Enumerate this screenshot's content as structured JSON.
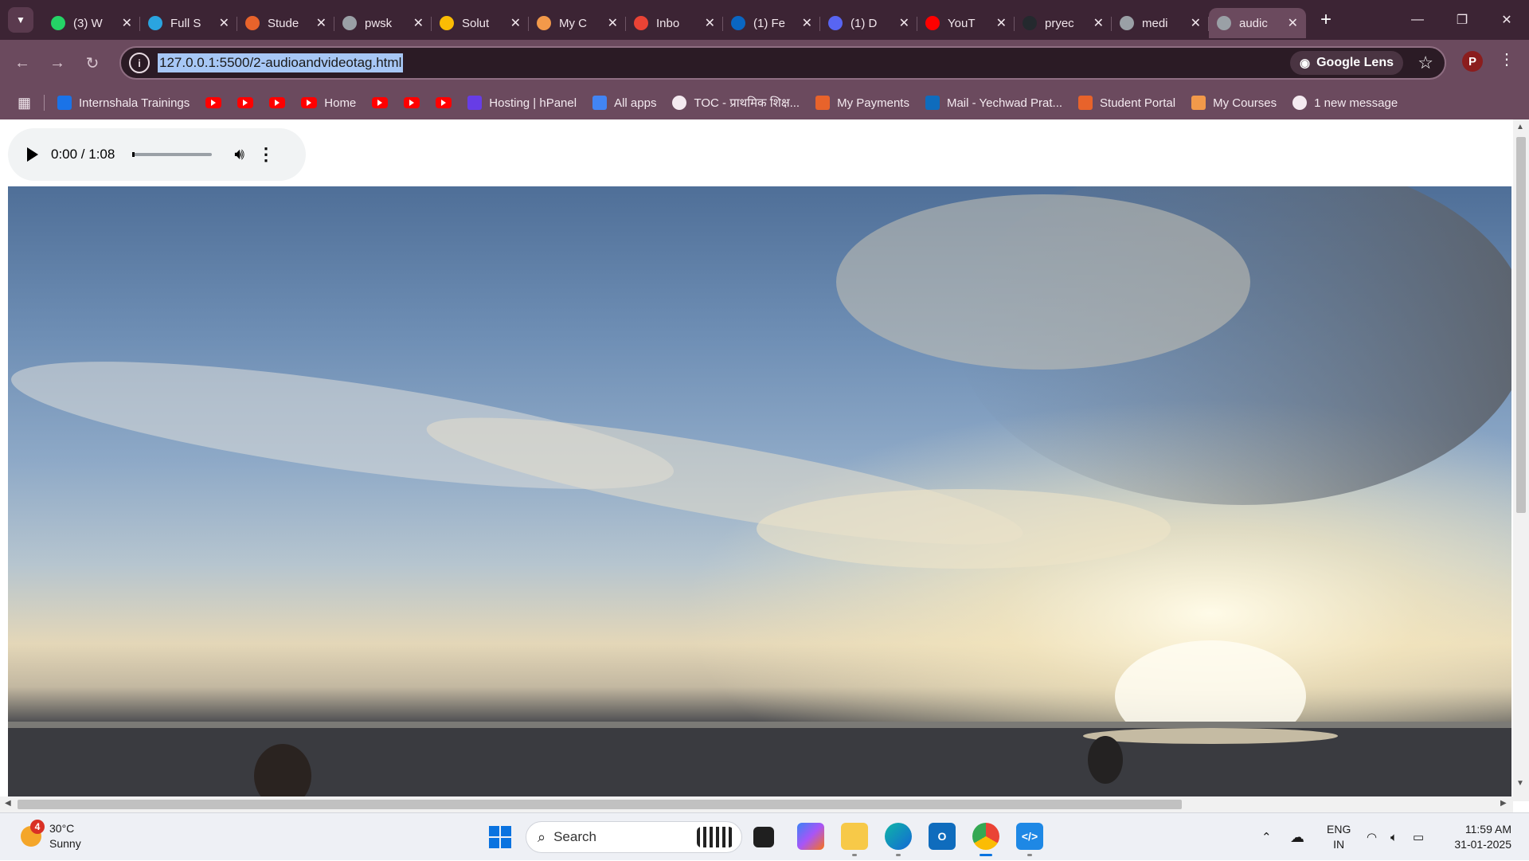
{
  "browser": {
    "tabs": [
      {
        "title": "(3) W",
        "icon": "whatsapp-icon",
        "color": "#25d366"
      },
      {
        "title": "Full S",
        "icon": "telegram-icon",
        "color": "#2aa4e0"
      },
      {
        "title": "Stude",
        "icon": "student-icon",
        "color": "#e8632b"
      },
      {
        "title": "pwsk",
        "icon": "globe-icon",
        "color": "#9aa0a6"
      },
      {
        "title": "Solut",
        "icon": "google-drive-icon",
        "color": "#fbbc04"
      },
      {
        "title": "My C",
        "icon": "courses-icon",
        "color": "#f2994a"
      },
      {
        "title": "Inbo",
        "icon": "gmail-icon",
        "color": "#ea4335"
      },
      {
        "title": "(1) Fe",
        "icon": "linkedin-icon",
        "color": "#0a66c2"
      },
      {
        "title": "(1) D",
        "icon": "discord-icon",
        "color": "#5865f2"
      },
      {
        "title": "YouT",
        "icon": "youtube-icon",
        "color": "#ff0000"
      },
      {
        "title": "pryec",
        "icon": "github-icon",
        "color": "#24292e"
      },
      {
        "title": "medi",
        "icon": "globe-icon",
        "color": "#9aa0a6"
      },
      {
        "title": "audic",
        "icon": "globe-icon",
        "color": "#9aa0a6",
        "active": true
      }
    ],
    "url": "127.0.0.1:5500/2-audioandvideotag.html",
    "lens_label": "Google Lens",
    "profile_initial": "P",
    "bookmarks": [
      {
        "label": "Internshala Trainings",
        "icon": "ist"
      },
      {
        "label": "",
        "icon": "yt"
      },
      {
        "label": "",
        "icon": "yt"
      },
      {
        "label": "",
        "icon": "yt"
      },
      {
        "label": "Home",
        "icon": "yt"
      },
      {
        "label": "",
        "icon": "yt"
      },
      {
        "label": "",
        "icon": "yt"
      },
      {
        "label": "",
        "icon": "yt"
      },
      {
        "label": "Hosting | hPanel",
        "icon": "hostinger"
      },
      {
        "label": "All apps",
        "icon": "apps"
      },
      {
        "label": "TOC - प्राथमिक शिक्ष...",
        "icon": "toc"
      },
      {
        "label": "My Payments",
        "icon": "payments"
      },
      {
        "label": "Mail - Yechwad Prat...",
        "icon": "outlook"
      },
      {
        "label": "Student Portal",
        "icon": "portal"
      },
      {
        "label": "My Courses",
        "icon": "courses"
      },
      {
        "label": "1 new message",
        "icon": "globe"
      }
    ]
  },
  "audio_player": {
    "time": "0:00 / 1:08",
    "progress": 0.0
  },
  "taskbar": {
    "weather_temp": "30°C",
    "weather_desc": "Sunny",
    "weather_badge": "4",
    "search_placeholder": "Search",
    "lang_top": "ENG",
    "lang_bottom": "IN",
    "time": "11:59 AM",
    "date": "31-01-2025"
  },
  "colors": {
    "titlebar": "#3c2434",
    "toolbar": "#6b4a5e",
    "windows_accent": "#0a73e0"
  }
}
